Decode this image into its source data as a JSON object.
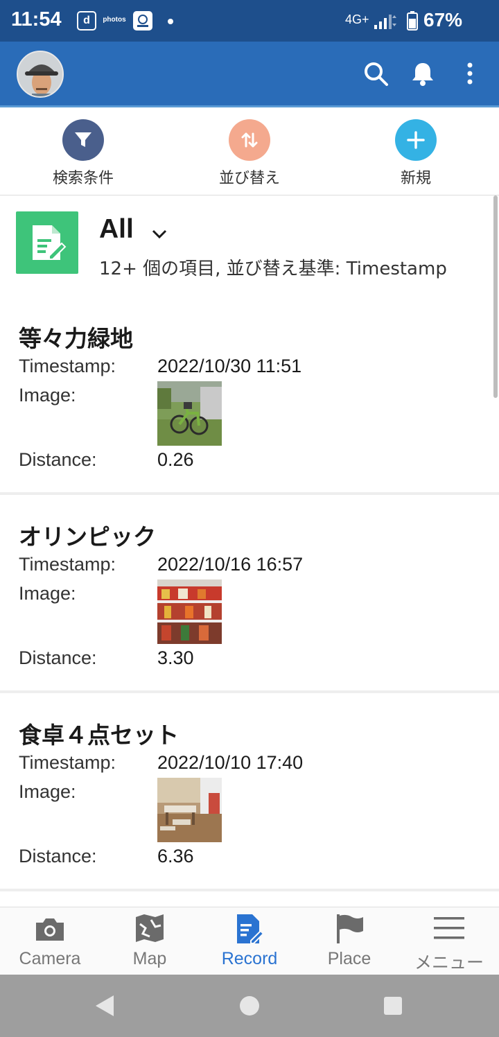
{
  "status_bar": {
    "time": "11:54",
    "icons": [
      "d",
      "photos",
      "app"
    ],
    "network": "4G+",
    "battery": "67%"
  },
  "app_bar": {
    "avatar_icon": "user-avatar",
    "actions": [
      "search-icon",
      "bell-icon",
      "more-vert-icon"
    ]
  },
  "toolbar": {
    "filter_label": "検索条件",
    "sort_label": "並び替え",
    "new_label": "新規",
    "colors": {
      "filter": "#4a5f8c",
      "sort": "#f4a98e",
      "new": "#34b2e4"
    }
  },
  "header": {
    "title": "All",
    "subtitle": "12+ 個の項目, 並び替え基準: Timestamp"
  },
  "field_labels": {
    "timestamp": "Timestamp:",
    "image": "Image:",
    "distance": "Distance:"
  },
  "records": [
    {
      "title": "等々力緑地",
      "timestamp": "2022/10/30 11:51",
      "distance": "0.26"
    },
    {
      "title": "オリンピック",
      "timestamp": "2022/10/16 16:57",
      "distance": "3.30"
    },
    {
      "title": "食卓４点セット",
      "timestamp": "2022/10/10 17:40",
      "distance": "6.36"
    }
  ],
  "bottom_nav": {
    "items": [
      {
        "label": "Camera",
        "icon": "camera-icon"
      },
      {
        "label": "Map",
        "icon": "map-icon"
      },
      {
        "label": "Record",
        "icon": "record-icon",
        "active": true
      },
      {
        "label": "Place",
        "icon": "flag-icon"
      },
      {
        "label": "メニュー",
        "icon": "menu-icon"
      }
    ]
  },
  "accent_color": "#2a73d1"
}
